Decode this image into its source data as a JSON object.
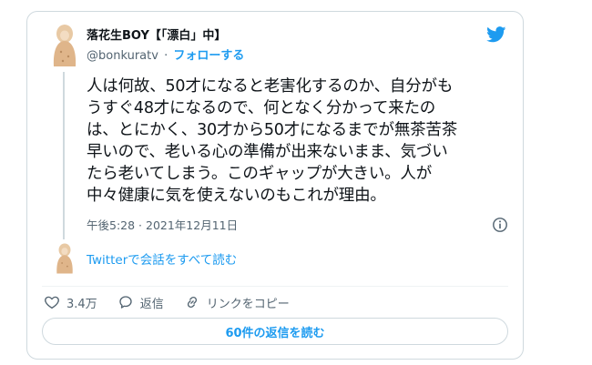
{
  "author": {
    "name": "落花生BOY【「漂白」中】",
    "handle": "@bonkuratv",
    "separator": "·",
    "follow_label": "フォローする"
  },
  "tweet": {
    "text": "人は何故、50才になると老害化するのか、自分がも\nうすぐ48才になるので、何となく分かって来たの\nは、とにかく、30才から50才になるまでが無茶苦茶\n早いので、老いる心の準備が出来ないまま、気づい\nたら老いてしまう。このギャップが大きい。人が\n中々健康に気を使えないのもこれが理由。",
    "timestamp": "午後5:28 · 2021年12月11日"
  },
  "thread": {
    "read_all_label": "Twitterで会話をすべて読む"
  },
  "actions": {
    "like_count": "3.4万",
    "reply_label": "返信",
    "copy_link_label": "リンクをコピー"
  },
  "replies_button_label": "60件の返信を読む",
  "icons": [
    "avatar-icon",
    "twitter-bird-icon",
    "info-icon",
    "heart-icon",
    "reply-icon",
    "link-icon"
  ],
  "colors": {
    "accent": "#1d9bf0",
    "muted": "#536471",
    "border": "#cfd9de"
  }
}
